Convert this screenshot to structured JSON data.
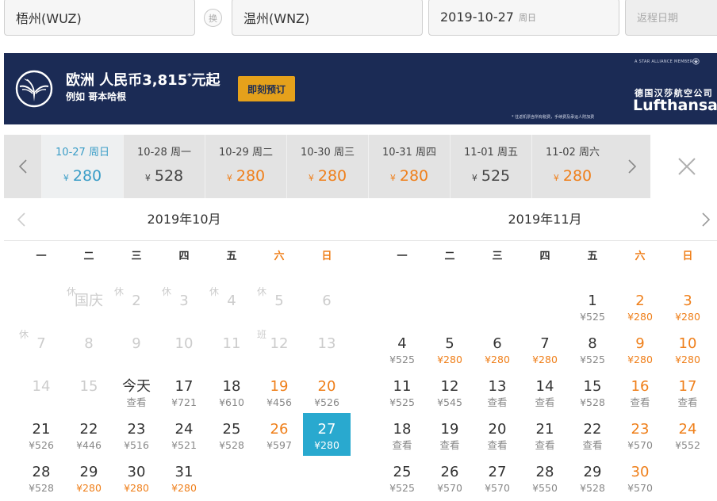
{
  "search": {
    "from_city": "梧州(WUZ)",
    "swap_label": "换",
    "to_city": "温州(WNZ)",
    "depart_date": "2019-10-27",
    "depart_weekday": "周日",
    "return_placeholder": "返程日期"
  },
  "banner": {
    "region": "欧洲",
    "price_text": "人民币3,815",
    "price_mark": "*",
    "price_suffix": "元起",
    "example": "例如 哥本哈根",
    "cta_label": "即刻预订",
    "alliance_text": "A STAR ALLIANCE MEMBER",
    "alliance_icon": "star-alliance-icon",
    "brand_cn": "德国汉莎航空公司",
    "brand_en": "Lufthansa",
    "logo_icon": "lufthansa-crane-icon",
    "disclaimer": "* 往返机票含所有税费，手续费及承运人附加费",
    "colors": {
      "background": "#1b2b55",
      "cta": "#e5a11b"
    }
  },
  "date_strip": {
    "prev_icon": "chevron-left-icon",
    "next_icon": "chevron-right-icon",
    "close_icon": "close-icon",
    "colors": {
      "selected_text": "#3a9dc7",
      "lowest_price": "#ef7f1a"
    },
    "items": [
      {
        "date": "10-27",
        "weekday": "周日",
        "currency": "¥",
        "price": "280",
        "selected": true,
        "lowest": true
      },
      {
        "date": "10-28",
        "weekday": "周一",
        "currency": "¥",
        "price": "528",
        "selected": false,
        "lowest": false
      },
      {
        "date": "10-29",
        "weekday": "周二",
        "currency": "¥",
        "price": "280",
        "selected": false,
        "lowest": true
      },
      {
        "date": "10-30",
        "weekday": "周三",
        "currency": "¥",
        "price": "280",
        "selected": false,
        "lowest": true
      },
      {
        "date": "10-31",
        "weekday": "周四",
        "currency": "¥",
        "price": "280",
        "selected": false,
        "lowest": true
      },
      {
        "date": "11-01",
        "weekday": "周五",
        "currency": "¥",
        "price": "525",
        "selected": false,
        "lowest": false
      },
      {
        "date": "11-02",
        "weekday": "周六",
        "currency": "¥",
        "price": "280",
        "selected": false,
        "lowest": true
      }
    ]
  },
  "calendar": {
    "prev_icon": "chevron-left-icon",
    "next_icon": "chevron-right-icon",
    "weekdays": [
      "一",
      "二",
      "三",
      "四",
      "五",
      "六",
      "日"
    ],
    "colors": {
      "weekend": "#ef7f1a",
      "lowest_price": "#ef7f1a",
      "selected_bg": "#29a9cf",
      "past": "#cccccc"
    },
    "months": [
      {
        "title": "2019年10月",
        "days": [
          {
            "text": "国庆",
            "tag": "休",
            "past": true
          },
          {
            "text": "2",
            "tag": "休",
            "past": true
          },
          {
            "text": "3",
            "tag": "休",
            "past": true
          },
          {
            "text": "4",
            "tag": "休",
            "past": true
          },
          {
            "text": "5",
            "tag": "休",
            "past": true
          },
          {
            "text": "6",
            "past": true
          },
          {
            "text": "7",
            "tag": "休",
            "past": true
          },
          {
            "text": "8",
            "past": true
          },
          {
            "text": "9",
            "past": true
          },
          {
            "text": "10",
            "past": true
          },
          {
            "text": "11",
            "past": true
          },
          {
            "text": "12",
            "tag": "班",
            "past": true
          },
          {
            "text": "13",
            "past": true
          },
          {
            "text": "14",
            "past": true
          },
          {
            "text": "15",
            "past": true
          },
          {
            "text": "今天",
            "price": "查看"
          },
          {
            "text": "17",
            "price": "¥721"
          },
          {
            "text": "18",
            "price": "¥610"
          },
          {
            "text": "19",
            "price": "¥456"
          },
          {
            "text": "20",
            "price": "¥526"
          },
          {
            "text": "21",
            "price": "¥526"
          },
          {
            "text": "22",
            "price": "¥446"
          },
          {
            "text": "23",
            "price": "¥516"
          },
          {
            "text": "24",
            "price": "¥521"
          },
          {
            "text": "25",
            "price": "¥528"
          },
          {
            "text": "26",
            "price": "¥597"
          },
          {
            "text": "27",
            "price": "¥280",
            "lowest": true,
            "selected": true
          },
          {
            "text": "28",
            "price": "¥528"
          },
          {
            "text": "29",
            "price": "¥280",
            "lowest": true
          },
          {
            "text": "30",
            "price": "¥280",
            "lowest": true
          },
          {
            "text": "31",
            "price": "¥280",
            "lowest": true
          }
        ]
      },
      {
        "title": "2019年11月",
        "days": [
          {
            "text": "1",
            "price": "¥525"
          },
          {
            "text": "2",
            "price": "¥280",
            "lowest": true
          },
          {
            "text": "3",
            "price": "¥280",
            "lowest": true
          },
          {
            "text": "4",
            "price": "¥525"
          },
          {
            "text": "5",
            "price": "¥280",
            "lowest": true
          },
          {
            "text": "6",
            "price": "¥280",
            "lowest": true
          },
          {
            "text": "7",
            "price": "¥280",
            "lowest": true
          },
          {
            "text": "8",
            "price": "¥525"
          },
          {
            "text": "9",
            "price": "¥280",
            "lowest": true
          },
          {
            "text": "10",
            "price": "¥280",
            "lowest": true
          },
          {
            "text": "11",
            "price": "¥525"
          },
          {
            "text": "12",
            "price": "¥545"
          },
          {
            "text": "13",
            "price": "查看"
          },
          {
            "text": "14",
            "price": "查看"
          },
          {
            "text": "15",
            "price": "¥528"
          },
          {
            "text": "16",
            "price": "查看"
          },
          {
            "text": "17",
            "price": "查看"
          },
          {
            "text": "18",
            "price": "查看"
          },
          {
            "text": "19",
            "price": "查看"
          },
          {
            "text": "20",
            "price": "查看"
          },
          {
            "text": "21",
            "price": "查看"
          },
          {
            "text": "22",
            "price": "查看"
          },
          {
            "text": "23",
            "price": "¥570"
          },
          {
            "text": "24",
            "price": "¥552"
          },
          {
            "text": "25",
            "price": "¥525"
          },
          {
            "text": "26",
            "price": "¥570"
          },
          {
            "text": "27",
            "price": "¥570"
          },
          {
            "text": "28",
            "price": "¥550"
          },
          {
            "text": "29",
            "price": "¥528"
          },
          {
            "text": "30",
            "price": "¥570"
          }
        ]
      }
    ]
  }
}
